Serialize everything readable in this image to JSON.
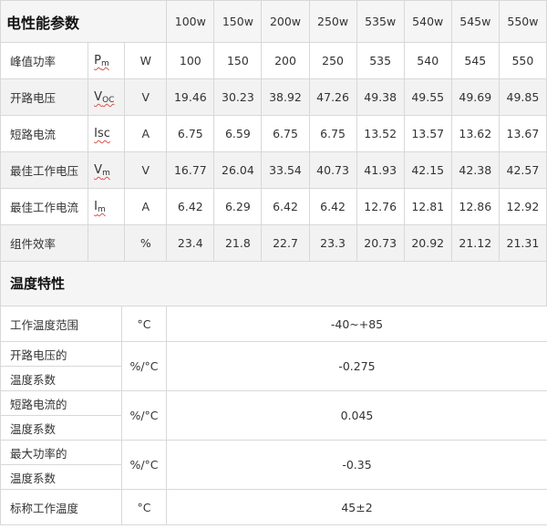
{
  "electrical": {
    "title": "电性能参数",
    "powers": [
      "100w",
      "150w",
      "200w",
      "250w",
      "535w",
      "540w",
      "545w",
      "550w"
    ],
    "rows": [
      {
        "name": "峰值功率",
        "sym_main": "P",
        "sym_sub": "m",
        "unit": "W",
        "values": [
          "100",
          "150",
          "200",
          "250",
          "535",
          "540",
          "545",
          "550"
        ]
      },
      {
        "name": "开路电压",
        "sym_main": "V",
        "sym_sub": "OC",
        "unit": "V",
        "values": [
          "19.46",
          "30.23",
          "38.92",
          "47.26",
          "49.38",
          "49.55",
          "49.69",
          "49.85"
        ]
      },
      {
        "name": "短路电流",
        "sym_main": "Isc",
        "sym_sub": "",
        "unit": "A",
        "values": [
          "6.75",
          "6.59",
          "6.75",
          "6.75",
          "13.52",
          "13.57",
          "13.62",
          "13.67"
        ]
      },
      {
        "name": "最佳工作电压",
        "sym_main": "V",
        "sym_sub": "m",
        "unit": "V",
        "values": [
          "16.77",
          "26.04",
          "33.54",
          "40.73",
          "41.93",
          "42.15",
          "42.38",
          "42.57"
        ]
      },
      {
        "name": "最佳工作电流",
        "sym_main": "I",
        "sym_sub": "m",
        "unit": "A",
        "values": [
          "6.42",
          "6.29",
          "6.42",
          "6.42",
          "12.76",
          "12.81",
          "12.86",
          "12.92"
        ]
      },
      {
        "name": "组件效率",
        "sym_main": "",
        "sym_sub": "",
        "unit": "%",
        "values": [
          "23.4",
          "21.8",
          "22.7",
          "23.3",
          "20.73",
          "20.92",
          "21.12",
          "21.31"
        ]
      }
    ]
  },
  "temperature": {
    "title": "温度特性",
    "rows": [
      {
        "name1": "工作温度范围",
        "name2": "",
        "unit": "°C",
        "value": "-40~+85"
      },
      {
        "name1": "开路电压的",
        "name2": "温度系数",
        "unit": "%/°C",
        "value": "-0.275"
      },
      {
        "name1": "短路电流的",
        "name2": "温度系数",
        "unit": "%/°C",
        "value": "0.045"
      },
      {
        "name1": "最大功率的",
        "name2": "温度系数",
        "unit": "%/°C",
        "value": "-0.35"
      },
      {
        "name1": "标称工作温度",
        "name2": "",
        "unit": "°C",
        "value": "45±2"
      }
    ]
  }
}
